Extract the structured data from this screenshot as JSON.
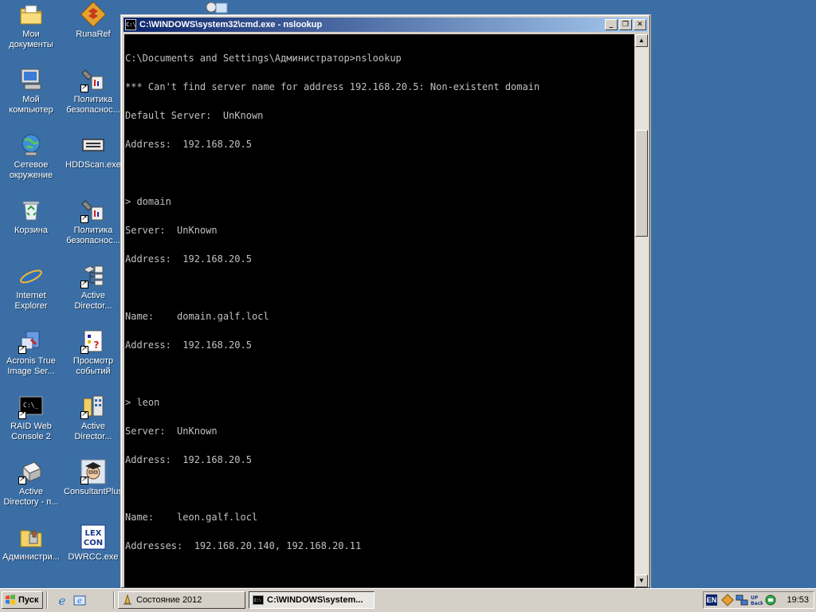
{
  "desktop": {
    "icons": [
      {
        "label": "Мои\nдокументы",
        "icon": "my-documents-icon"
      },
      {
        "label": "RunaRef",
        "icon": "runaref-icon"
      },
      {
        "label": "Мой\nкомпьютер",
        "icon": "my-computer-icon"
      },
      {
        "label": "Политика\nбезопаснос...",
        "icon": "security-policy-icon"
      },
      {
        "label": "Сетевое\nокружение",
        "icon": "network-places-icon"
      },
      {
        "label": "HDDScan.exe",
        "icon": "hddscan-icon"
      },
      {
        "label": "Корзина",
        "icon": "recycle-bin-icon"
      },
      {
        "label": "Политика\nбезопаснос...",
        "icon": "security-policy-icon"
      },
      {
        "label": "Internet\nExplorer",
        "icon": "internet-explorer-icon"
      },
      {
        "label": "Active\nDirector...",
        "icon": "active-directory-icon"
      },
      {
        "label": "Acronis True\nImage Ser...",
        "icon": "acronis-icon"
      },
      {
        "label": "Просмотр\nсобытий",
        "icon": "event-viewer-icon"
      },
      {
        "label": "RAID Web\nConsole 2",
        "icon": "raid-console-icon"
      },
      {
        "label": "Active\nDirector...",
        "icon": "active-directory-sites-icon"
      },
      {
        "label": "Active\nDirectory - п...",
        "icon": "active-directory-users-icon"
      },
      {
        "label": "ConsultantPlus",
        "icon": "consultantplus-icon"
      },
      {
        "label": "Администри...",
        "icon": "admin-tools-icon"
      },
      {
        "label": "DWRCC.exe",
        "icon": "dwrcc-icon"
      }
    ]
  },
  "window": {
    "title": "C:\\WINDOWS\\system32\\cmd.exe - nslookup",
    "icon_text": "C:\\",
    "minimize_glyph": "_",
    "maximize_glyph": "❐",
    "close_glyph": "✕"
  },
  "console": {
    "lines": [
      "C:\\Documents and Settings\\Администратор>nslookup",
      "*** Can't find server name for address 192.168.20.5: Non-existent domain",
      "Default Server:  UnKnown",
      "Address:  192.168.20.5",
      "",
      "> domain",
      "Server:  UnKnown",
      "Address:  192.168.20.5",
      "",
      "Name:    domain.galf.locl",
      "Address:  192.168.20.5",
      "",
      "> leon",
      "Server:  UnKnown",
      "Address:  192.168.20.5",
      "",
      "Name:    leon.galf.locl",
      "Addresses:  192.168.20.140, 192.168.20.11",
      ""
    ],
    "prompt": "> "
  },
  "scrollbar": {
    "up_glyph": "▲",
    "down_glyph": "▼"
  },
  "taskbar": {
    "start_label": "Пуск",
    "tasks": [
      {
        "label": "Состояние 2012",
        "active": false
      },
      {
        "label": "C:\\WINDOWS\\system...",
        "active": true
      }
    ],
    "tray": {
      "language": "EN",
      "clock": "19:53"
    }
  }
}
